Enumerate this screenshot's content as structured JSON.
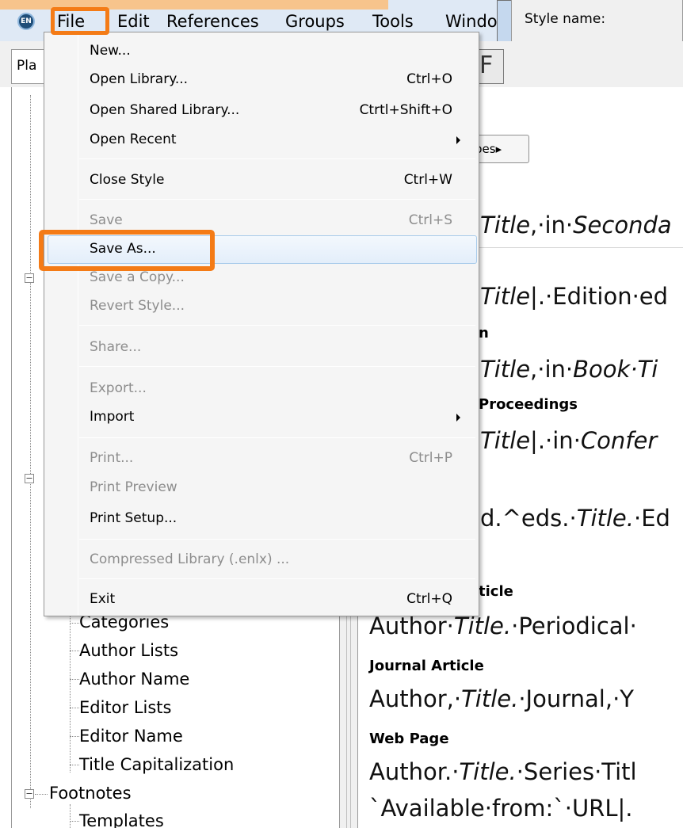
{
  "menubar": {
    "icon": "endnote-app-icon",
    "items": [
      "File",
      "Edit",
      "References",
      "Groups",
      "Tools",
      "Windo"
    ]
  },
  "toolbar": {
    "place_label": "Pla",
    "types_button": "pes▸",
    "f_button": "F"
  },
  "dialog": {
    "style_name_label": "Style name:"
  },
  "file_menu": {
    "items": [
      {
        "label": "New...",
        "shortcut": "",
        "enabled": true
      },
      {
        "label": "Open Library...",
        "shortcut": "Ctrl+O",
        "enabled": true
      },
      {
        "label": "Open Shared Library...",
        "shortcut": "Ctrtl+Shift+O",
        "enabled": true
      },
      {
        "label": "Open Recent",
        "shortcut": "",
        "enabled": true,
        "submenu": true
      },
      {
        "label": "Close Style",
        "shortcut": "Ctrl+W",
        "enabled": true
      },
      {
        "label": "Save",
        "shortcut": "Ctrl+S",
        "enabled": false
      },
      {
        "label": "Save As...",
        "shortcut": "",
        "enabled": true,
        "highlighted": true
      },
      {
        "label": "Save a Copy...",
        "shortcut": "",
        "enabled": false
      },
      {
        "label": "Revert Style...",
        "shortcut": "",
        "enabled": false
      },
      {
        "label": "Share...",
        "shortcut": "",
        "enabled": false
      },
      {
        "label": "Export...",
        "shortcut": "",
        "enabled": false
      },
      {
        "label": "Import",
        "shortcut": "",
        "enabled": true,
        "submenu": true
      },
      {
        "label": "Print...",
        "shortcut": "Ctrl+P",
        "enabled": false
      },
      {
        "label": "Print Preview",
        "shortcut": "",
        "enabled": false
      },
      {
        "label": "Print Setup...",
        "shortcut": "",
        "enabled": true
      },
      {
        "label": "Compressed Library (.enlx) ...",
        "shortcut": "",
        "enabled": false
      },
      {
        "label": "Exit",
        "shortcut": "Ctrl+Q",
        "enabled": true
      }
    ]
  },
  "tree": {
    "items": [
      "Categories",
      "Author Lists",
      "Author Name",
      "Editor Lists",
      "Editor Name",
      "Title Capitalization",
      "Footnotes",
      "Templates"
    ]
  },
  "preview": {
    "lines": [
      {
        "plain_before": "",
        "italic": "Title",
        "plain_after": ",·in·",
        "italic2": "Seconda"
      },
      {
        "plain_before": "",
        "italic": "Title",
        "plain_after": "|.·Edition·ed",
        "italic2": ""
      },
      {
        "plain_before": "",
        "italic": "Title",
        "plain_after": ",·in·",
        "italic2": "Book·Ti"
      },
      {
        "plain_before": "",
        "italic": "Title",
        "plain_after": "|.·in·",
        "italic2": "Confer"
      },
      {
        "plain_before": "d.^eds.·",
        "italic": "Title.",
        "plain_after": "·Ed",
        "italic2": ""
      },
      {
        "plain_before": "Author·",
        "italic": "Title.",
        "plain_after": "·Periodical·",
        "italic2": ""
      },
      {
        "plain_before": "Author,·",
        "italic": "Title.",
        "plain_after": "·Journal,·Y",
        "italic2": ""
      },
      {
        "plain_before": "Author.·",
        "italic": "Title.",
        "plain_after": "·Series·Titl",
        "italic2": ""
      },
      {
        "plain_before": "`Available·from:`·URL|.",
        "italic": "",
        "plain_after": "",
        "italic2": ""
      }
    ],
    "headings": [
      "n",
      "Proceedings",
      "ticle",
      "Journal Article",
      "Web Page"
    ]
  },
  "colors": {
    "callout": "#f47b16",
    "menu_highlight": "#e3eefa"
  }
}
